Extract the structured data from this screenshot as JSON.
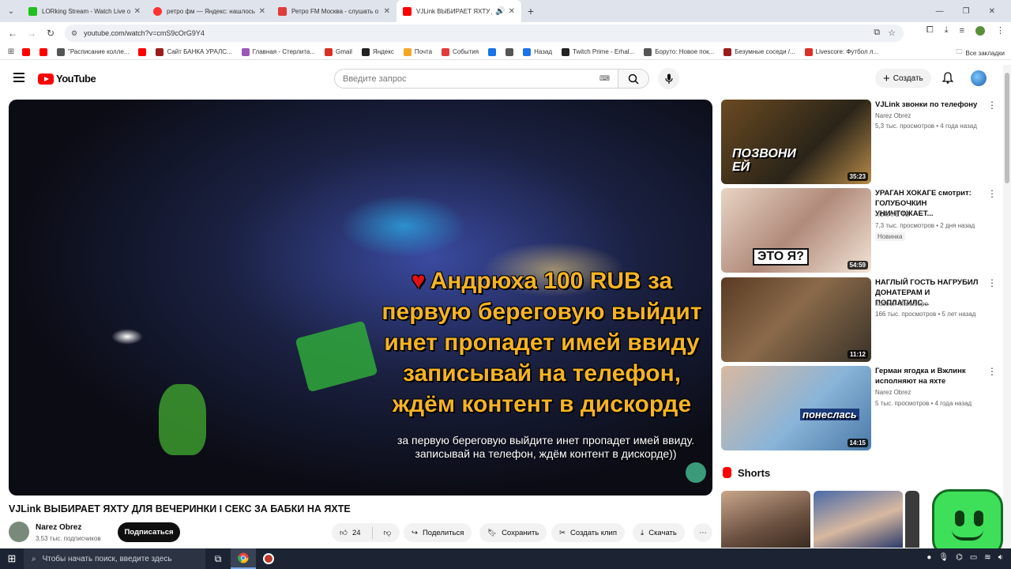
{
  "browser": {
    "tabs": [
      {
        "title": "LORking Stream - Watch Live o",
        "color": "#20c020",
        "active": false
      },
      {
        "title": "ретро фм — Яндекс: нашлось",
        "color": "#ff3333",
        "active": false
      },
      {
        "title": "Ретро FM Москва - слушать о",
        "color": "#e03c3c",
        "active": false
      },
      {
        "title": "VJLink ВЫБИРАЕТ ЯХТУ ДЛ",
        "color": "#ff0000",
        "active": true
      }
    ],
    "url": "youtube.com/watch?v=cmS9cOrG9Y4",
    "bookmarks": [
      {
        "label": "",
        "color": "#ff0000"
      },
      {
        "label": "",
        "color": "#ff0000"
      },
      {
        "label": "\"Расписание колле...",
        "color": "#555555"
      },
      {
        "label": "",
        "color": "#ff0000"
      },
      {
        "label": "Сайт БАНКА УРАЛС...",
        "color": "#9b1c1c"
      },
      {
        "label": "Главная - Стерлита...",
        "color": "#9b59b6"
      },
      {
        "label": "Gmail",
        "color": "#d93025"
      },
      {
        "label": "Яндекс",
        "color": "#222222"
      },
      {
        "label": "Почта",
        "color": "#f5a623"
      },
      {
        "label": "События",
        "color": "#e03c3c"
      },
      {
        "label": "",
        "color": "#1a73e8"
      },
      {
        "label": "",
        "color": "#555555"
      },
      {
        "label": "Назад",
        "color": "#1a73e8"
      },
      {
        "label": "Twitch Prime - Erhal...",
        "color": "#222222"
      },
      {
        "label": "Боруто: Новое пок...",
        "color": "#555555"
      },
      {
        "label": "Безумные соседи /...",
        "color": "#9b1c1c"
      },
      {
        "label": "Livescore: Футбол л...",
        "color": "#d93025"
      }
    ],
    "all_bookmarks": "Все закладки"
  },
  "header": {
    "logo_text": "YouTube",
    "search_placeholder": "Введите запрос",
    "create_label": "Создать"
  },
  "video": {
    "overlay_lines": [
      "Андрюха  100 RUB за",
      "первую береговую выйдит",
      "инет пропадет имей ввиду",
      "записывай на телефон,",
      "ждём контент в дискорде"
    ],
    "subtitle_lines": [
      "за первую береговую выйдите инет пропадет имей ввиду.",
      "записывай на телефон, ждём контент в дискорде))"
    ],
    "title": "VJLink ВЫБИРАЕТ ЯХТУ ДЛЯ ВЕЧЕРИНКИ I СЕКС ЗА БАБКИ НА ЯХТЕ",
    "channel": "Narez Obrez",
    "subscribers": "3,53 тыс. подписчиков",
    "subscribe_label": "Подписаться",
    "likes": "24",
    "share_label": "Поделиться",
    "save_label": "Сохранить",
    "clip_label": "Создать клип",
    "download_label": "Скачать"
  },
  "recommendations": [
    {
      "title": "VJLink звонки по телефону",
      "channel": "Narez Obrez",
      "meta": "5,3 тыс. просмотров • 4 года назад",
      "duration": "35:23",
      "thumb_text": "ПОЗВОНИ ЕЙ",
      "badge": ""
    },
    {
      "title": "УРАГАН ХОКАГЕ смотрит: ГОЛУБОЧКИН УНИЧТОЖАЕТ...",
      "channel": "ХОКАГЕ ТВ",
      "meta": "7,3 тыс. просмотров • 2 дня назад",
      "duration": "54:59",
      "thumb_text": "ЭТО Я?",
      "badge": "Новинка"
    },
    {
      "title": "НАГЛЫЙ ГОСТЬ НАГРУБИЛ ДОНАТЕРАМ И ПОПЛАТИЛС...",
      "channel": "Ковбой Мальборо",
      "meta": "166 тыс. просмотров • 5 лет назад",
      "duration": "11:12",
      "thumb_text": "",
      "badge": ""
    },
    {
      "title": "Герман ягодка и Вжлинк исполняют на яхте",
      "channel": "Narez Obrez",
      "meta": "5 тыс. просмотров • 4 года назад",
      "duration": "14:15",
      "thumb_text": "понеслась",
      "badge": ""
    }
  ],
  "shorts_label": "Shorts",
  "taskbar": {
    "search_placeholder": "Чтобы начать поиск, введите здесь"
  }
}
